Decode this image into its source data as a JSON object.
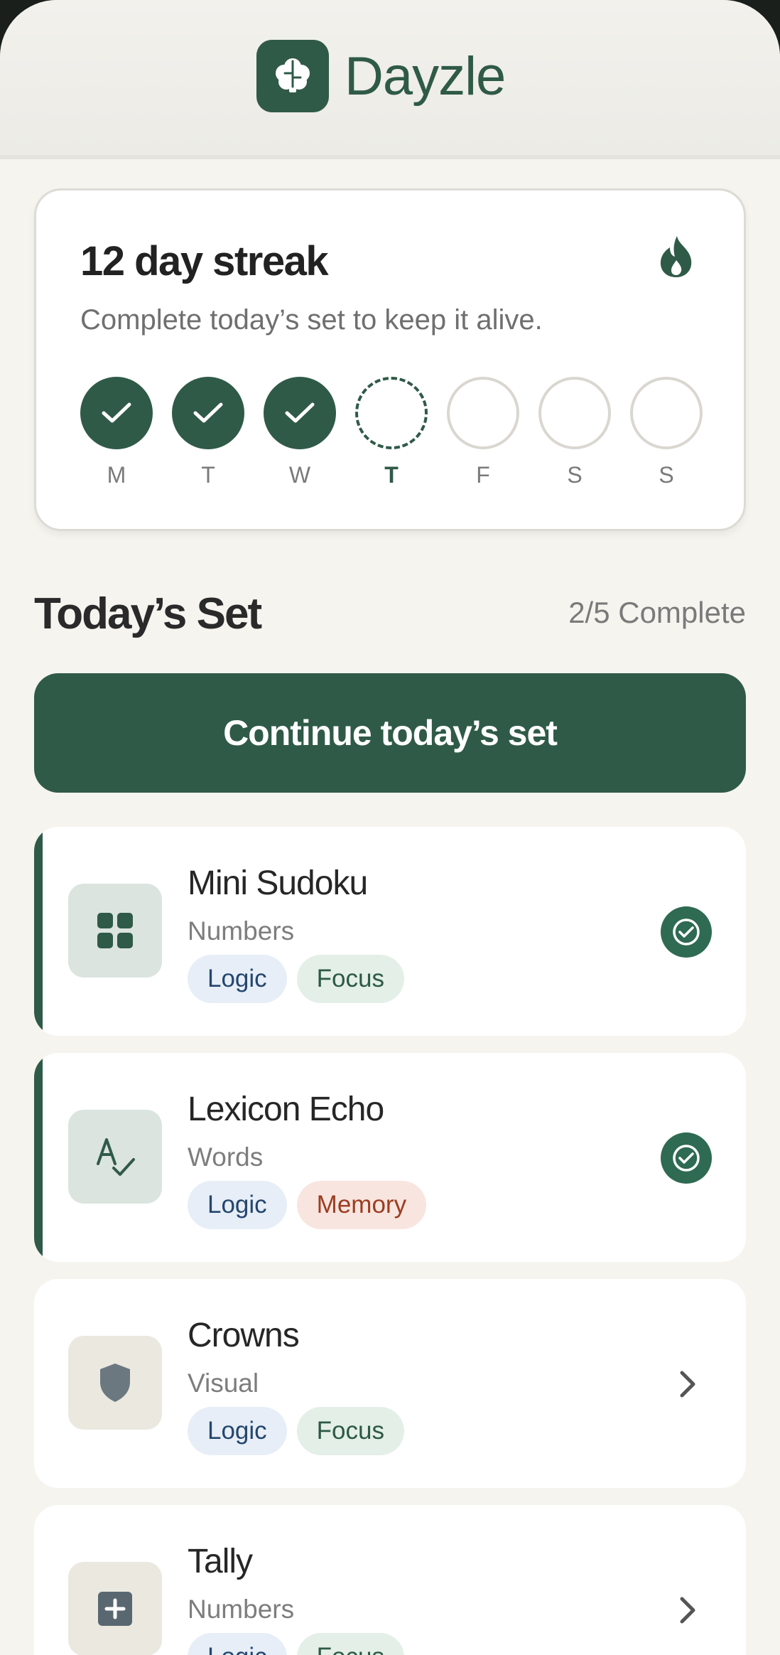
{
  "app": {
    "name": "Dayzle",
    "logo_icon": "brain-puzzle-icon"
  },
  "streak": {
    "title": "12 day streak",
    "subtitle": "Complete today’s set to keep it alive.",
    "icon": "flame-icon",
    "days": [
      {
        "label": "M",
        "state": "done"
      },
      {
        "label": "T",
        "state": "done"
      },
      {
        "label": "W",
        "state": "done"
      },
      {
        "label": "T",
        "state": "today"
      },
      {
        "label": "F",
        "state": "empty"
      },
      {
        "label": "S",
        "state": "empty"
      },
      {
        "label": "S",
        "state": "empty"
      }
    ]
  },
  "today": {
    "title": "Today’s Set",
    "progress_text": "2/5 Complete",
    "cta_label": "Continue today’s set"
  },
  "games": [
    {
      "name": "Mini Sudoku",
      "category": "Numbers",
      "tags": [
        "Logic",
        "Focus"
      ],
      "status": "complete",
      "icon": "grid-icon"
    },
    {
      "name": "Lexicon Echo",
      "category": "Words",
      "tags": [
        "Logic",
        "Memory"
      ],
      "status": "complete",
      "icon": "spellcheck-icon"
    },
    {
      "name": "Crowns",
      "category": "Visual",
      "tags": [
        "Logic",
        "Focus"
      ],
      "status": "pending",
      "icon": "shield-icon"
    },
    {
      "name": "Tally",
      "category": "Numbers",
      "tags": [
        "Logic",
        "Focus"
      ],
      "status": "pending",
      "icon": "plus-box-icon"
    }
  ],
  "colors": {
    "primary": "#2f5a47",
    "background": "#f5f4ef",
    "card": "#ffffff"
  }
}
